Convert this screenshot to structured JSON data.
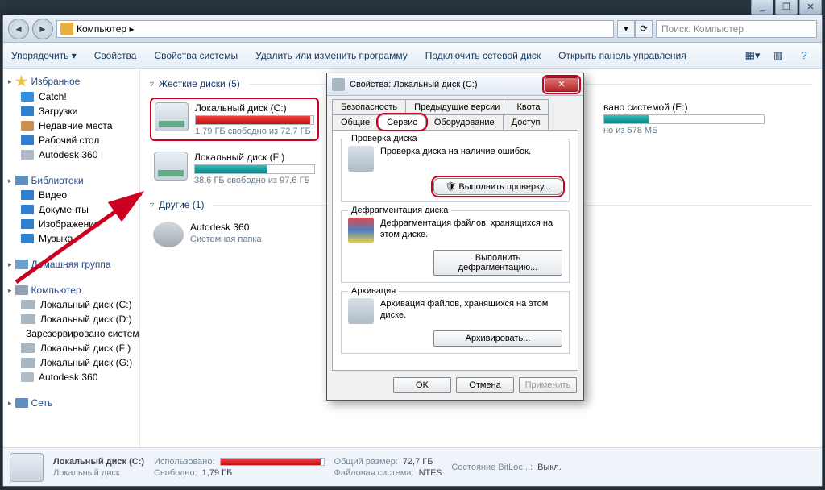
{
  "window_controls": {
    "min": "_",
    "max": "❐",
    "close": "✕"
  },
  "address": {
    "location": "Компьютер  ▸",
    "refresh": "⟳",
    "search_placeholder": "Поиск: Компьютер"
  },
  "toolbar": {
    "organize": "Упорядочить ▾",
    "properties": "Свойства",
    "sys_properties": "Свойства системы",
    "uninstall": "Удалить или изменить программу",
    "map_drive": "Подключить сетевой диск",
    "control_panel": "Открыть панель управления"
  },
  "sidebar": {
    "favorites": {
      "head": "Избранное",
      "items": [
        "Catch!",
        "Загрузки",
        "Недавние места",
        "Рабочий стол",
        "Autodesk 360"
      ]
    },
    "libraries": {
      "head": "Библиотеки",
      "items": [
        "Видео",
        "Документы",
        "Изображения",
        "Музыка"
      ]
    },
    "homegroup": {
      "head": "Домашняя группа"
    },
    "computer": {
      "head": "Компьютер",
      "items": [
        "Локальный диск (C:)",
        "Локальный диск (D:)",
        "Зарезервировано системой",
        "Локальный диск (F:)",
        "Локальный диск (G:)",
        "Autodesk 360"
      ]
    },
    "network": {
      "head": "Сеть"
    }
  },
  "groups": {
    "hdd": {
      "title": "Жесткие диски (5)"
    },
    "other": {
      "title": "Другие (1)"
    }
  },
  "drives": [
    {
      "name": "Локальный диск (C:)",
      "sub": "1,79 ГБ свободно из 72,7 ГБ",
      "fill": 97,
      "color": "red",
      "selected": true
    },
    {
      "name": "вано системой (E:)",
      "sub": "но из 578 МБ",
      "fill": 28,
      "color": "teal",
      "selected": false,
      "offset": true
    },
    {
      "name": "Локальный диск (F:)",
      "sub": "38,6 ГБ свободно из 97,6 ГБ",
      "fill": 60,
      "color": "teal",
      "selected": false
    }
  ],
  "other_folder": {
    "name": "Autodesk 360",
    "sub": "Системная папка"
  },
  "status": {
    "name": "Локальный диск (C:)",
    "type": "Локальный диск",
    "used_label": "Использовано:",
    "free_label": "Свободно:",
    "free_val": "1,79 ГБ",
    "size_label": "Общий размер:",
    "size_val": "72,7 ГБ",
    "fs_label": "Файловая система:",
    "fs_val": "NTFS",
    "bitlocker_label": "Состояние BitLoc...:",
    "bitlocker_val": "Выкл."
  },
  "dialog": {
    "title": "Свойства: Локальный диск (C:)",
    "tabs_top": [
      "Безопасность",
      "Предыдущие версии",
      "Квота"
    ],
    "tabs_bottom": [
      "Общие",
      "Сервис",
      "Оборудование",
      "Доступ"
    ],
    "active_tab": "Сервис",
    "check": {
      "legend": "Проверка диска",
      "text": "Проверка диска на наличие ошибок.",
      "btn": "Выполнить проверку..."
    },
    "defrag": {
      "legend": "Дефрагментация диска",
      "text": "Дефрагментация файлов, хранящихся на этом диске.",
      "btn": "Выполнить дефрагментацию..."
    },
    "backup": {
      "legend": "Архивация",
      "text": "Архивация файлов, хранящихся на этом диске.",
      "btn": "Архивировать..."
    },
    "ok": "OK",
    "cancel": "Отмена",
    "apply": "Применить"
  }
}
